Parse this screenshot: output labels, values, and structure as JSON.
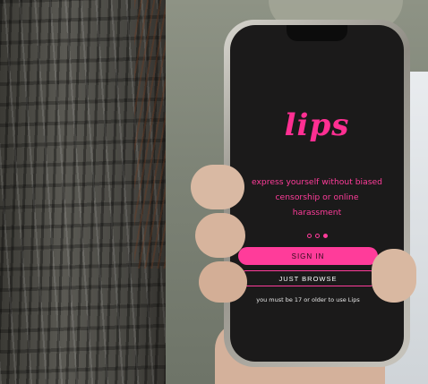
{
  "app": {
    "logo_text": "lips",
    "tagline": "express yourself without biased censorship or online harassment",
    "pager": {
      "count": 3,
      "active_index": 2
    },
    "signin_label": "SIGN IN",
    "browse_label": "JUST BROWSE",
    "age_notice": "you must be 17 or older to use Lips"
  },
  "colors": {
    "accent": "#ff3c9a",
    "screen_bg": "#1b1a1a"
  }
}
